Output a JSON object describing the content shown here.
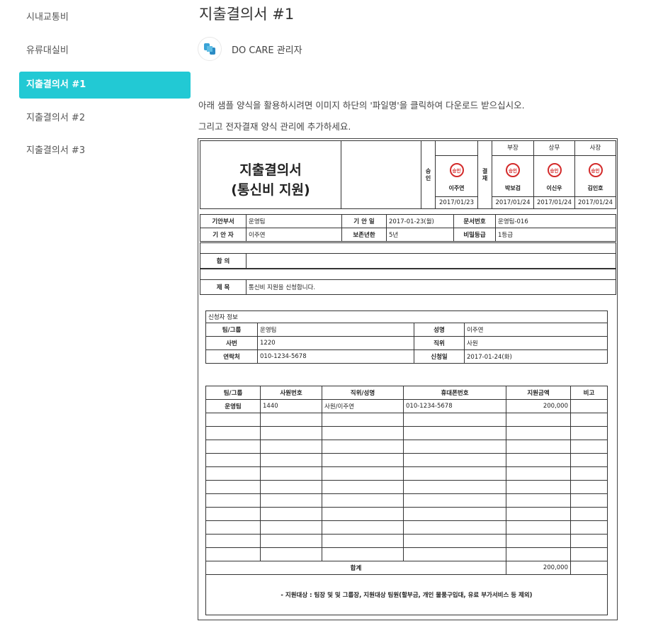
{
  "sidebar": {
    "items": [
      {
        "label": "시내교통비",
        "active": false
      },
      {
        "label": "유류대실비",
        "active": false
      },
      {
        "label": "지출결의서 #1",
        "active": true
      },
      {
        "label": "지출결의서 #2",
        "active": false
      },
      {
        "label": "지출결의서 #3",
        "active": false
      }
    ],
    "accent_color": "#22c9d4"
  },
  "page": {
    "title": "지출결의서 #1",
    "author": "DO CARE 관리자",
    "desc_line1": "아래 샘플 양식을 활용하시려면 이미지 하단의 '파일명'을 클릭하여 다운로드 받으십시오.",
    "desc_line2": "그리고 전자결재 양식 관리에 추가하세요."
  },
  "doc": {
    "title_line1": "지출결의서",
    "title_line2": "(통신비 지원)",
    "approve_label": "승인",
    "approve_person": "이주연",
    "approve_date": "2017/01/23",
    "sign_label": "결재",
    "stamp_text": "승인",
    "signers": [
      {
        "role": "부장",
        "name": "박보검",
        "date": "2017/01/24"
      },
      {
        "role": "상무",
        "name": "이신우",
        "date": "2017/01/24"
      },
      {
        "role": "사장",
        "name": "김인호",
        "date": "2017/01/24"
      }
    ],
    "meta": {
      "dept_label": "기안부서",
      "dept": "운영팀",
      "date_label": "기 안 일",
      "date": "2017-01-23(월)",
      "docno_label": "문서번호",
      "docno": "운영팀-016",
      "drafter_label": "기 안 자",
      "drafter": "이주연",
      "retention_label": "보존년한",
      "retention": "5년",
      "security_label": "비밀등급",
      "security": "1등급"
    },
    "agree_label": "합   의",
    "subject_label": "제   목",
    "subject": "통신비 지원을 신청합니다.",
    "applicant": {
      "header": "신청자 정보",
      "team_label": "팀/그룹",
      "team": "운영팀",
      "name_label": "성명",
      "name": "이주연",
      "empno_label": "사번",
      "empno": "1220",
      "position_label": "직위",
      "position": "사원",
      "contact_label": "연락처",
      "contact": "010-1234-5678",
      "applydate_label": "신청일",
      "applydate": "2017-01-24(화)"
    },
    "support": {
      "columns": [
        "팀/그룹",
        "사원번호",
        "직위/성명",
        "휴대폰번호",
        "지원금액",
        "비고"
      ],
      "rows": [
        [
          "운영팀",
          "1440",
          "사원/이주연",
          "010-1234-5678",
          "200,000",
          ""
        ]
      ],
      "total_label": "합계",
      "total": "200,000"
    },
    "note": "- 지원대상 : 팀장 및 및 그룹장, 지원대상 팀원(할부금, 개인 물품구입대, 유료 부가서비스 등 제외)"
  }
}
